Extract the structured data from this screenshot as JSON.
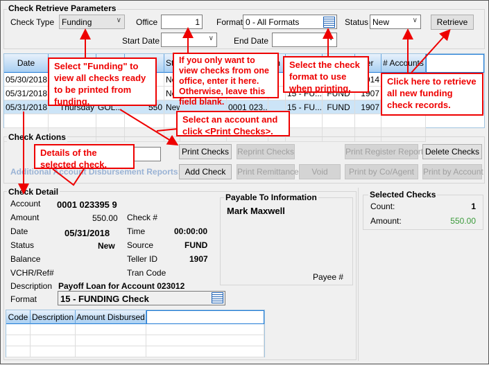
{
  "params": {
    "title": "Check Retrieve Parameters",
    "check_type_label": "Check Type",
    "check_type_value": "Funding",
    "office_label": "Office",
    "office_value": "1",
    "format_label": "Format",
    "format_value": "0 - All Formats",
    "status_label": "Status",
    "status_value": "New",
    "retrieve_label": "Retrieve",
    "start_date_label": "Start Date",
    "start_date_value": "",
    "end_date_label": "End Date",
    "end_date_value": ""
  },
  "grid": {
    "headers": [
      "Date",
      "",
      "",
      "",
      "Sta",
      "",
      "",
      "m",
      "",
      "",
      "ller",
      "# Accounts"
    ],
    "rows": [
      [
        "05/30/2018",
        "",
        "",
        "",
        "Ne",
        "",
        "",
        "",
        "",
        "",
        "914",
        ""
      ],
      [
        "05/31/2018",
        "",
        "",
        "",
        "Ne",
        "",
        "",
        "",
        "15 - FU...",
        "FUND",
        "1907",
        ""
      ],
      [
        "05/31/2018",
        "Thursday",
        "GOL...",
        "550",
        "New",
        "",
        "0001 023...",
        "",
        "15 - FU...",
        "FUND",
        "1907",
        ""
      ]
    ],
    "selected_row": 2
  },
  "actions": {
    "title": "Check Actions",
    "additional_reports_label": "Additional Account Disbursement Reports:",
    "print_checks": "Print Checks",
    "reprint_checks": "Reprint Checks",
    "print_register_report": "Print Register Report",
    "delete_checks": "Delete Checks",
    "add_check": "Add Check",
    "print_remittance": "Print Remittance",
    "void": "Void",
    "print_by_co_agent": "Print by Co/Agent",
    "print_by_account": "Print by Account"
  },
  "detail": {
    "title": "Check Detail",
    "account_label": "Account",
    "account": "0001 023395 9",
    "amount_label": "Amount",
    "amount": "550.00",
    "check_no_label": "Check #",
    "check_no": "",
    "date_label": "Date",
    "date": "05/31/2018",
    "time_label": "Time",
    "time": "00:00:00",
    "status_label": "Status",
    "status": "New",
    "source_label": "Source",
    "source": "FUND",
    "balance_label": "Balance",
    "teller_label": "Teller ID",
    "teller": "1907",
    "vchr_label": "VCHR/Ref#",
    "tran_code_label": "Tran Code",
    "description_label": "Description",
    "description": "Payoff  Loan for Account 023012",
    "format_label": "Format",
    "format": "15 - FUNDING Check",
    "disb_headers": [
      "Code",
      "Description",
      "Amount Disbursed",
      ""
    ]
  },
  "payable": {
    "title": "Payable To Information",
    "name": "Mark Maxwell",
    "payee_label": "Payee #"
  },
  "selected": {
    "title": "Selected Checks",
    "count_label": "Count:",
    "count": "1",
    "amount_label": "Amount:",
    "amount": "550.00",
    "amount_color": "#3a9a3a"
  },
  "callouts": {
    "funding": "Select \"Funding\" to view all checks ready to be printed from funding.",
    "office": "If you only want to view checks from one office, enter it here. Otherwise, leave this field blank.",
    "format": "Select the check format to use when printing.",
    "retrieve": "Click here to retrieve all new funding check records.",
    "select_account": "Select an account and click <Print Checks>.",
    "details": "Details of the selected check."
  },
  "colors": {
    "callout": "#e00000",
    "selected_row": "#cce4f7",
    "header": "#a9cff2"
  }
}
